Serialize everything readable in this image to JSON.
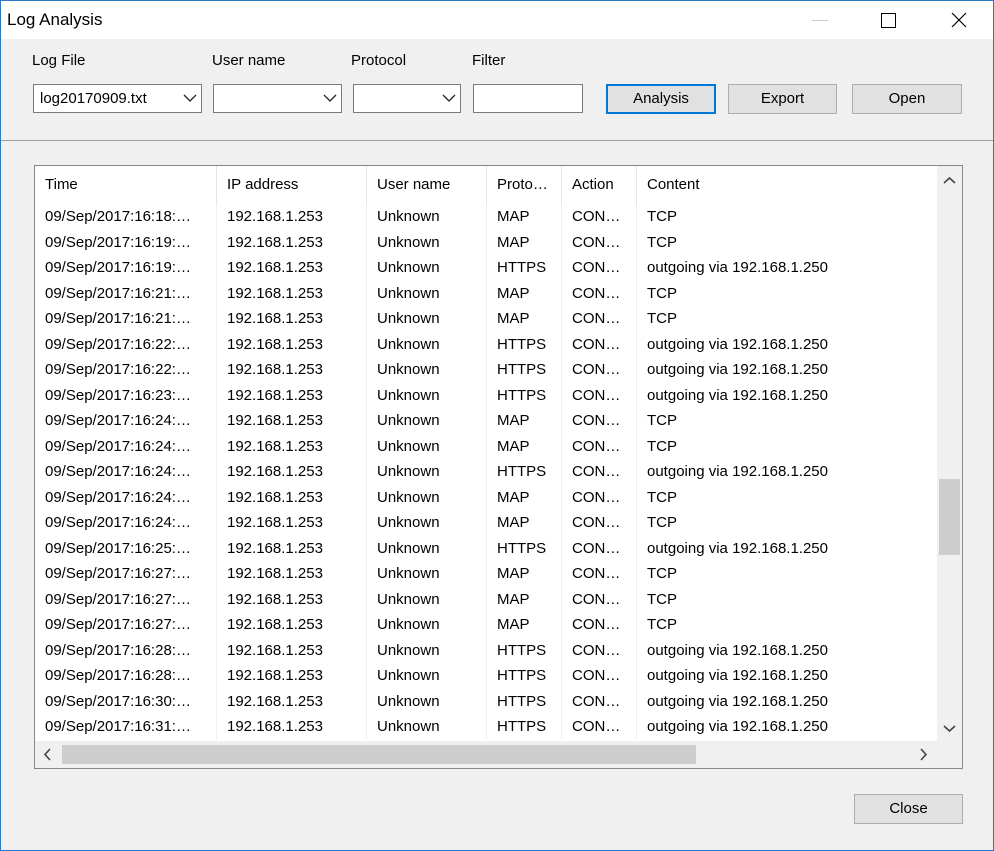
{
  "window": {
    "title": "Log Analysis"
  },
  "toolbar": {
    "log_file_label": "Log File",
    "log_file_value": "log20170909.txt",
    "user_name_label": "User name",
    "user_name_value": "",
    "protocol_label": "Protocol",
    "protocol_value": "",
    "filter_label": "Filter",
    "filter_value": "",
    "analysis_label": "Analysis",
    "export_label": "Export",
    "open_label": "Open"
  },
  "table": {
    "columns": [
      "Time",
      "IP address",
      "User name",
      "Proto…",
      "Action",
      "Content"
    ],
    "rows": [
      [
        "09/Sep/2017:16:18:…",
        "192.168.1.253",
        "Unknown",
        "MAP",
        "CON…",
        "TCP"
      ],
      [
        "09/Sep/2017:16:19:…",
        "192.168.1.253",
        "Unknown",
        "MAP",
        "CON…",
        "TCP"
      ],
      [
        "09/Sep/2017:16:19:…",
        "192.168.1.253",
        "Unknown",
        "HTTPS",
        "CON…",
        "outgoing via 192.168.1.250"
      ],
      [
        "09/Sep/2017:16:21:…",
        "192.168.1.253",
        "Unknown",
        "MAP",
        "CON…",
        "TCP"
      ],
      [
        "09/Sep/2017:16:21:…",
        "192.168.1.253",
        "Unknown",
        "MAP",
        "CON…",
        "TCP"
      ],
      [
        "09/Sep/2017:16:22:…",
        "192.168.1.253",
        "Unknown",
        "HTTPS",
        "CON…",
        "outgoing via 192.168.1.250"
      ],
      [
        "09/Sep/2017:16:22:…",
        "192.168.1.253",
        "Unknown",
        "HTTPS",
        "CON…",
        "outgoing via 192.168.1.250"
      ],
      [
        "09/Sep/2017:16:23:…",
        "192.168.1.253",
        "Unknown",
        "HTTPS",
        "CON…",
        "outgoing via 192.168.1.250"
      ],
      [
        "09/Sep/2017:16:24:…",
        "192.168.1.253",
        "Unknown",
        "MAP",
        "CON…",
        "TCP"
      ],
      [
        "09/Sep/2017:16:24:…",
        "192.168.1.253",
        "Unknown",
        "MAP",
        "CON…",
        "TCP"
      ],
      [
        "09/Sep/2017:16:24:…",
        "192.168.1.253",
        "Unknown",
        "HTTPS",
        "CON…",
        "outgoing via 192.168.1.250"
      ],
      [
        "09/Sep/2017:16:24:…",
        "192.168.1.253",
        "Unknown",
        "MAP",
        "CON…",
        "TCP"
      ],
      [
        "09/Sep/2017:16:24:…",
        "192.168.1.253",
        "Unknown",
        "MAP",
        "CON…",
        "TCP"
      ],
      [
        "09/Sep/2017:16:25:…",
        "192.168.1.253",
        "Unknown",
        "HTTPS",
        "CON…",
        "outgoing via 192.168.1.250"
      ],
      [
        "09/Sep/2017:16:27:…",
        "192.168.1.253",
        "Unknown",
        "MAP",
        "CON…",
        "TCP"
      ],
      [
        "09/Sep/2017:16:27:…",
        "192.168.1.253",
        "Unknown",
        "MAP",
        "CON…",
        "TCP"
      ],
      [
        "09/Sep/2017:16:27:…",
        "192.168.1.253",
        "Unknown",
        "MAP",
        "CON…",
        "TCP"
      ],
      [
        "09/Sep/2017:16:28:…",
        "192.168.1.253",
        "Unknown",
        "HTTPS",
        "CON…",
        "outgoing via 192.168.1.250"
      ],
      [
        "09/Sep/2017:16:28:…",
        "192.168.1.253",
        "Unknown",
        "HTTPS",
        "CON…",
        "outgoing via 192.168.1.250"
      ],
      [
        "09/Sep/2017:16:30:…",
        "192.168.1.253",
        "Unknown",
        "HTTPS",
        "CON…",
        "outgoing via 192.168.1.250"
      ],
      [
        "09/Sep/2017:16:31:…",
        "192.168.1.253",
        "Unknown",
        "HTTPS",
        "CON…",
        "outgoing via 192.168.1.250"
      ]
    ]
  },
  "footer": {
    "close_label": "Close"
  },
  "icons": {
    "minimize": "minimize-icon",
    "maximize": "maximize-icon",
    "close": "close-icon",
    "dropdown": "chevron-down-icon",
    "scroll_up": "arrow-up-icon",
    "scroll_down": "arrow-down-icon",
    "scroll_left": "arrow-left-icon",
    "scroll_right": "arrow-right-icon"
  },
  "colors": {
    "accent": "#0078d7",
    "window_border": "#2b78c5",
    "background": "#f0f0f0"
  }
}
